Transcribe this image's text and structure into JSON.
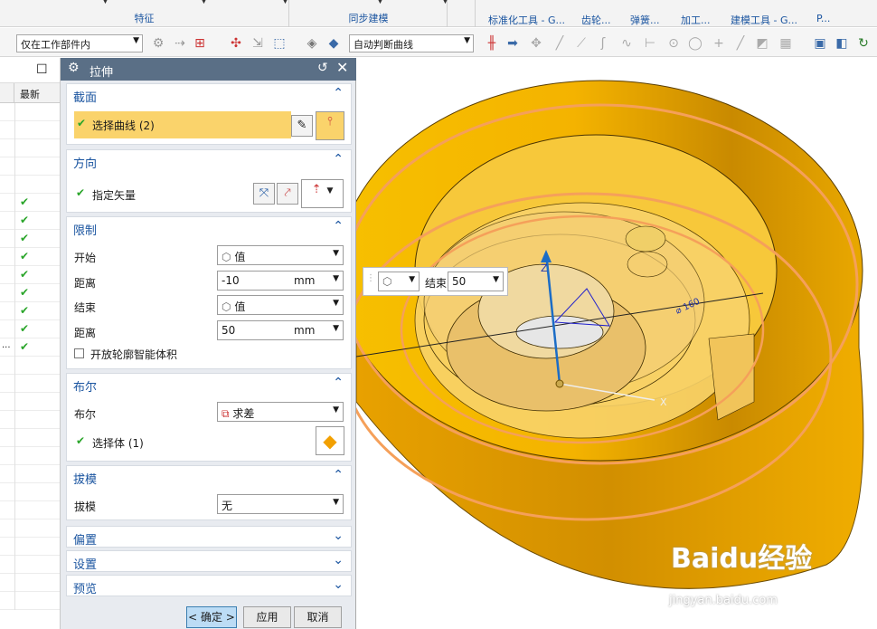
{
  "ribbon": {
    "groups": [
      {
        "label": "特征"
      },
      {
        "label": "同步建模"
      }
    ],
    "tabs": [
      "标准化工具 - G...",
      "齿轮...",
      "弹簧...",
      "加工...",
      "建模工具 - G...",
      "P..."
    ]
  },
  "toolbar": {
    "scope_filter": "仅在工作部件内",
    "curve_rule": "自动判断曲线"
  },
  "nav": {
    "column_latest": "最新",
    "check_count": 9,
    "checkmark": "✔",
    "ellipsis": "..."
  },
  "dialog": {
    "title": "拉伸",
    "sections": {
      "section": {
        "header": "截面",
        "select_curve": "选择曲线 (2)"
      },
      "direction": {
        "header": "方向",
        "specify_vector": "指定矢量"
      },
      "limits": {
        "header": "限制",
        "start_label": "开始",
        "start_type": "值",
        "distance_label": "距离",
        "start_distance": "-10",
        "unit": "mm",
        "end_label": "结束",
        "end_type": "值",
        "end_distance_label": "距离",
        "end_distance": "50",
        "open_profile": "开放轮廓智能体积"
      },
      "boolean": {
        "header": "布尔",
        "boolean_label": "布尔",
        "boolean_value": "求差",
        "select_body": "选择体 (1)"
      },
      "draft": {
        "header": "拔模",
        "draft_label": "拔模",
        "draft_value": "无"
      },
      "offset": {
        "header": "偏置"
      },
      "settings": {
        "header": "设置"
      },
      "preview": {
        "header": "预览"
      }
    },
    "buttons": {
      "ok": "< 确定 >",
      "apply": "应用",
      "cancel": "取消"
    }
  },
  "viewport": {
    "float_label": "结束",
    "float_value": "50",
    "axis_z": "Z",
    "axis_x": "X",
    "dimension": "⌀ 160",
    "watermark": "Baidu经验",
    "watermark_url": "jingyan.baidu.com"
  },
  "colors": {
    "body": "#f4b300",
    "edge": "#f5a05a",
    "titlebar": "#5a6f86",
    "selection": "#fad36b"
  }
}
